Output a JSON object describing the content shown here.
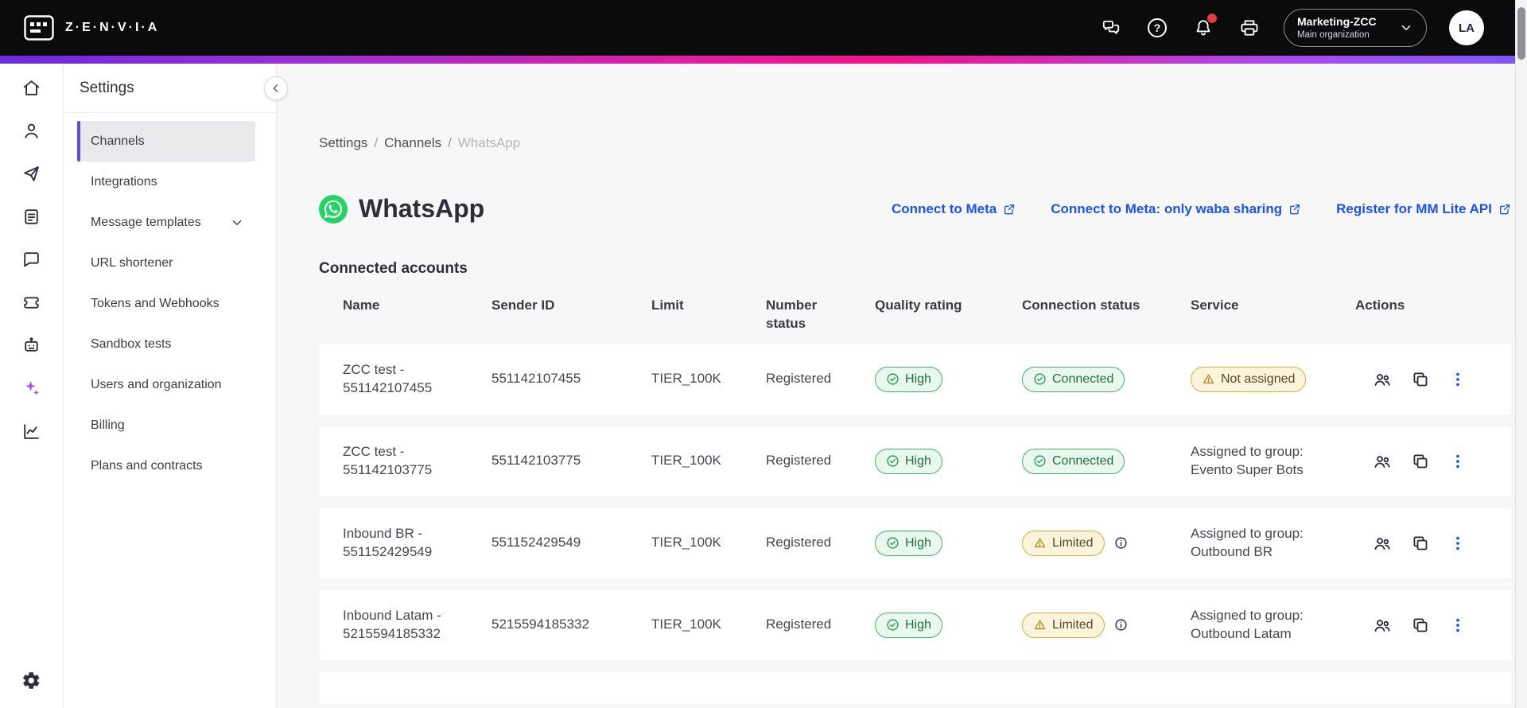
{
  "topbar": {
    "brand": "Z·E·N·V·I·A",
    "help_glyph": "?",
    "org": {
      "name": "Marketing-ZCC",
      "subtitle": "Main organization"
    },
    "avatar_initials": "LA"
  },
  "sidebar": {
    "title": "Settings",
    "items": [
      {
        "label": "Channels"
      },
      {
        "label": "Integrations"
      },
      {
        "label": "Message templates"
      },
      {
        "label": "URL shortener"
      },
      {
        "label": "Tokens and Webhooks"
      },
      {
        "label": "Sandbox tests"
      },
      {
        "label": "Users and organization"
      },
      {
        "label": "Billing"
      },
      {
        "label": "Plans and contracts"
      }
    ]
  },
  "breadcrumb": {
    "items": [
      "Settings",
      "Channels",
      "WhatsApp"
    ]
  },
  "page": {
    "title": "WhatsApp",
    "links": [
      "Connect to Meta",
      "Connect to Meta: only waba sharing",
      "Register for MM Lite API"
    ],
    "section": "Connected accounts"
  },
  "table": {
    "headers": [
      "Name",
      "Sender ID",
      "Limit",
      "Number status",
      "Quality rating",
      "Connection status",
      "Service",
      "Actions"
    ],
    "rows": [
      {
        "name": "ZCC test - 551142107455",
        "sender_id": "551142107455",
        "limit": "TIER_100K",
        "number_status": "Registered",
        "quality": "High",
        "connection": "Connected",
        "service_pill": "Not assigned"
      },
      {
        "name": "ZCC test - 551142103775",
        "sender_id": "551142103775",
        "limit": "TIER_100K",
        "number_status": "Registered",
        "quality": "High",
        "connection": "Connected",
        "service_label": "Assigned to group:",
        "service_group": "Evento Super Bots"
      },
      {
        "name": "Inbound BR - 551152429549",
        "sender_id": "551152429549",
        "limit": "TIER_100K",
        "number_status": "Registered",
        "quality": "High",
        "connection": "Limited",
        "service_label": "Assigned to group:",
        "service_group": "Outbound BR"
      },
      {
        "name": "Inbound Latam - 5215594185332",
        "sender_id": "5215594185332",
        "limit": "TIER_100K",
        "number_status": "Registered",
        "quality": "High",
        "connection": "Limited",
        "service_label": "Assigned to group:",
        "service_group": "Outbound Latam"
      }
    ]
  },
  "colors": {
    "accent_purple": "#6748e6",
    "link_blue": "#1a53f0",
    "success_green": "#2d9e55",
    "warning_yellow": "#d6ad3e",
    "whatsapp_green": "#25D366",
    "notification_red": "#e23c3c"
  }
}
